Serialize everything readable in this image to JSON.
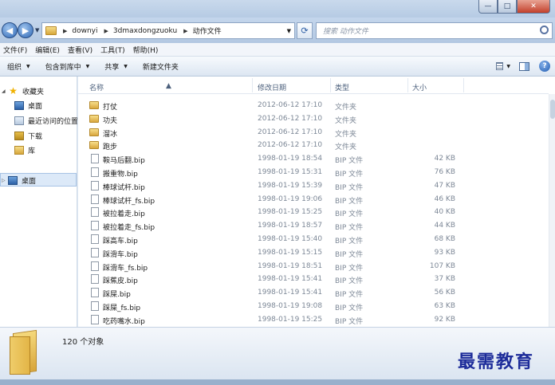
{
  "window": {
    "controls": {
      "minimize": "—",
      "maximize": "□",
      "close": "✕"
    }
  },
  "address": {
    "back": "◀",
    "forward": "▶",
    "breadcrumbs": [
      "downyi",
      "3dmaxdongzuoku",
      "动作文件"
    ],
    "search_placeholder": "搜索 动作文件"
  },
  "menu": [
    "文件(F)",
    "编辑(E)",
    "查看(V)",
    "工具(T)",
    "帮助(H)"
  ],
  "toolbar": {
    "organize": "组织",
    "include_in_library": "包含到库中",
    "share": "共享",
    "new_folder": "新建文件夹"
  },
  "nav": {
    "favorites": "收藏夹",
    "desktop_fav": "桌面",
    "recent": "最近访问的位置",
    "downloads": "下载",
    "library": "库",
    "desktop": "桌面"
  },
  "columns": {
    "name": "名称",
    "date": "修改日期",
    "type": "类型",
    "size": "大小"
  },
  "files": [
    {
      "name": "打仗",
      "date": "2012-06-12 17:10",
      "type": "文件夹",
      "size": "",
      "kind": "folder"
    },
    {
      "name": "功夫",
      "date": "2012-06-12 17:10",
      "type": "文件夹",
      "size": "",
      "kind": "folder"
    },
    {
      "name": "溜冰",
      "date": "2012-06-12 17:10",
      "type": "文件夹",
      "size": "",
      "kind": "folder"
    },
    {
      "name": "跑步",
      "date": "2012-06-12 17:10",
      "type": "文件夹",
      "size": "",
      "kind": "folder"
    },
    {
      "name": "鞍马后翻.bip",
      "date": "1998-01-19 18:54",
      "type": "BIP 文件",
      "size": "42 KB",
      "kind": "bip"
    },
    {
      "name": "搬重物.bip",
      "date": "1998-01-19 15:31",
      "type": "BIP 文件",
      "size": "76 KB",
      "kind": "bip"
    },
    {
      "name": "棒球试杆.bip",
      "date": "1998-01-19 15:39",
      "type": "BIP 文件",
      "size": "47 KB",
      "kind": "bip"
    },
    {
      "name": "棒球试杆_fs.bip",
      "date": "1998-01-19 19:06",
      "type": "BIP 文件",
      "size": "46 KB",
      "kind": "bip"
    },
    {
      "name": "被拉着走.bip",
      "date": "1998-01-19 15:25",
      "type": "BIP 文件",
      "size": "40 KB",
      "kind": "bip"
    },
    {
      "name": "被拉着走_fs.bip",
      "date": "1998-01-19 18:57",
      "type": "BIP 文件",
      "size": "44 KB",
      "kind": "bip"
    },
    {
      "name": "踩高车.bip",
      "date": "1998-01-19 15:40",
      "type": "BIP 文件",
      "size": "68 KB",
      "kind": "bip"
    },
    {
      "name": "踩滑车.bip",
      "date": "1998-01-19 15:15",
      "type": "BIP 文件",
      "size": "93 KB",
      "kind": "bip"
    },
    {
      "name": "踩滑车_fs.bip",
      "date": "1998-01-19 18:51",
      "type": "BIP 文件",
      "size": "107 KB",
      "kind": "bip"
    },
    {
      "name": "踩蕉皮.bip",
      "date": "1998-01-19 15:41",
      "type": "BIP 文件",
      "size": "37 KB",
      "kind": "bip"
    },
    {
      "name": "踩屎.bip",
      "date": "1998-01-19 15:41",
      "type": "BIP 文件",
      "size": "56 KB",
      "kind": "bip"
    },
    {
      "name": "踩屎_fs.bip",
      "date": "1998-01-19 19:08",
      "type": "BIP 文件",
      "size": "63 KB",
      "kind": "bip"
    },
    {
      "name": "吃药嘴水.bip",
      "date": "1998-01-19 15:25",
      "type": "BIP 文件",
      "size": "92 KB",
      "kind": "bip"
    }
  ],
  "status": {
    "count": "120 个对象"
  },
  "watermark": "最需教育"
}
